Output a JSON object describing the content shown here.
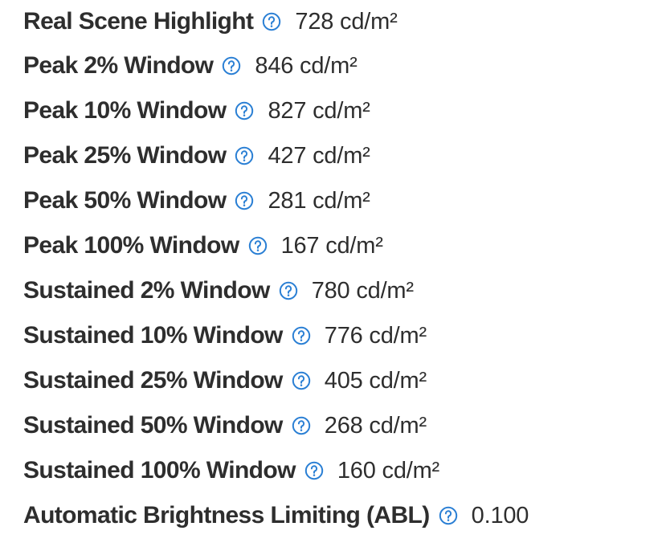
{
  "accent_color": "#2a7fd4",
  "text_color": "#2e2e2e",
  "help_icon": "question-circle-icon",
  "specs": [
    {
      "label": "Real Scene Highlight",
      "value": "728 cd/m²"
    },
    {
      "label": "Peak 2% Window",
      "value": "846 cd/m²"
    },
    {
      "label": "Peak 10% Window",
      "value": "827 cd/m²"
    },
    {
      "label": "Peak 25% Window",
      "value": "427 cd/m²"
    },
    {
      "label": "Peak 50% Window",
      "value": "281 cd/m²"
    },
    {
      "label": "Peak 100% Window",
      "value": "167 cd/m²"
    },
    {
      "label": "Sustained 2% Window",
      "value": "780 cd/m²"
    },
    {
      "label": "Sustained 10% Window",
      "value": "776 cd/m²"
    },
    {
      "label": "Sustained 25% Window",
      "value": "405 cd/m²"
    },
    {
      "label": "Sustained 50% Window",
      "value": "268 cd/m²"
    },
    {
      "label": "Sustained 100% Window",
      "value": "160 cd/m²"
    },
    {
      "label": "Automatic Brightness Limiting (ABL)",
      "value": "0.100"
    }
  ]
}
